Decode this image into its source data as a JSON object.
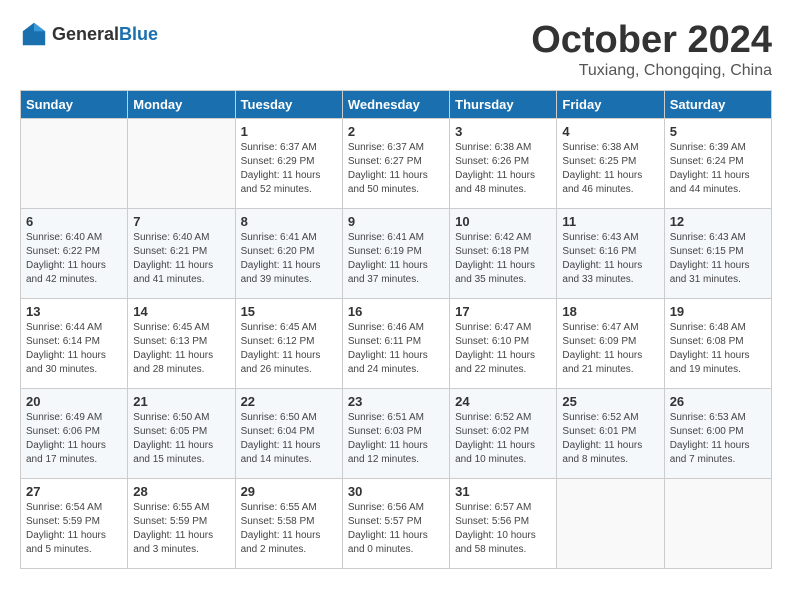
{
  "header": {
    "logo_general": "General",
    "logo_blue": "Blue",
    "month": "October 2024",
    "location": "Tuxiang, Chongqing, China"
  },
  "weekdays": [
    "Sunday",
    "Monday",
    "Tuesday",
    "Wednesday",
    "Thursday",
    "Friday",
    "Saturday"
  ],
  "weeks": [
    [
      {
        "day": "",
        "info": ""
      },
      {
        "day": "",
        "info": ""
      },
      {
        "day": "1",
        "info": "Sunrise: 6:37 AM\nSunset: 6:29 PM\nDaylight: 11 hours\nand 52 minutes."
      },
      {
        "day": "2",
        "info": "Sunrise: 6:37 AM\nSunset: 6:27 PM\nDaylight: 11 hours\nand 50 minutes."
      },
      {
        "day": "3",
        "info": "Sunrise: 6:38 AM\nSunset: 6:26 PM\nDaylight: 11 hours\nand 48 minutes."
      },
      {
        "day": "4",
        "info": "Sunrise: 6:38 AM\nSunset: 6:25 PM\nDaylight: 11 hours\nand 46 minutes."
      },
      {
        "day": "5",
        "info": "Sunrise: 6:39 AM\nSunset: 6:24 PM\nDaylight: 11 hours\nand 44 minutes."
      }
    ],
    [
      {
        "day": "6",
        "info": "Sunrise: 6:40 AM\nSunset: 6:22 PM\nDaylight: 11 hours\nand 42 minutes."
      },
      {
        "day": "7",
        "info": "Sunrise: 6:40 AM\nSunset: 6:21 PM\nDaylight: 11 hours\nand 41 minutes."
      },
      {
        "day": "8",
        "info": "Sunrise: 6:41 AM\nSunset: 6:20 PM\nDaylight: 11 hours\nand 39 minutes."
      },
      {
        "day": "9",
        "info": "Sunrise: 6:41 AM\nSunset: 6:19 PM\nDaylight: 11 hours\nand 37 minutes."
      },
      {
        "day": "10",
        "info": "Sunrise: 6:42 AM\nSunset: 6:18 PM\nDaylight: 11 hours\nand 35 minutes."
      },
      {
        "day": "11",
        "info": "Sunrise: 6:43 AM\nSunset: 6:16 PM\nDaylight: 11 hours\nand 33 minutes."
      },
      {
        "day": "12",
        "info": "Sunrise: 6:43 AM\nSunset: 6:15 PM\nDaylight: 11 hours\nand 31 minutes."
      }
    ],
    [
      {
        "day": "13",
        "info": "Sunrise: 6:44 AM\nSunset: 6:14 PM\nDaylight: 11 hours\nand 30 minutes."
      },
      {
        "day": "14",
        "info": "Sunrise: 6:45 AM\nSunset: 6:13 PM\nDaylight: 11 hours\nand 28 minutes."
      },
      {
        "day": "15",
        "info": "Sunrise: 6:45 AM\nSunset: 6:12 PM\nDaylight: 11 hours\nand 26 minutes."
      },
      {
        "day": "16",
        "info": "Sunrise: 6:46 AM\nSunset: 6:11 PM\nDaylight: 11 hours\nand 24 minutes."
      },
      {
        "day": "17",
        "info": "Sunrise: 6:47 AM\nSunset: 6:10 PM\nDaylight: 11 hours\nand 22 minutes."
      },
      {
        "day": "18",
        "info": "Sunrise: 6:47 AM\nSunset: 6:09 PM\nDaylight: 11 hours\nand 21 minutes."
      },
      {
        "day": "19",
        "info": "Sunrise: 6:48 AM\nSunset: 6:08 PM\nDaylight: 11 hours\nand 19 minutes."
      }
    ],
    [
      {
        "day": "20",
        "info": "Sunrise: 6:49 AM\nSunset: 6:06 PM\nDaylight: 11 hours\nand 17 minutes."
      },
      {
        "day": "21",
        "info": "Sunrise: 6:50 AM\nSunset: 6:05 PM\nDaylight: 11 hours\nand 15 minutes."
      },
      {
        "day": "22",
        "info": "Sunrise: 6:50 AM\nSunset: 6:04 PM\nDaylight: 11 hours\nand 14 minutes."
      },
      {
        "day": "23",
        "info": "Sunrise: 6:51 AM\nSunset: 6:03 PM\nDaylight: 11 hours\nand 12 minutes."
      },
      {
        "day": "24",
        "info": "Sunrise: 6:52 AM\nSunset: 6:02 PM\nDaylight: 11 hours\nand 10 minutes."
      },
      {
        "day": "25",
        "info": "Sunrise: 6:52 AM\nSunset: 6:01 PM\nDaylight: 11 hours\nand 8 minutes."
      },
      {
        "day": "26",
        "info": "Sunrise: 6:53 AM\nSunset: 6:00 PM\nDaylight: 11 hours\nand 7 minutes."
      }
    ],
    [
      {
        "day": "27",
        "info": "Sunrise: 6:54 AM\nSunset: 5:59 PM\nDaylight: 11 hours\nand 5 minutes."
      },
      {
        "day": "28",
        "info": "Sunrise: 6:55 AM\nSunset: 5:59 PM\nDaylight: 11 hours\nand 3 minutes."
      },
      {
        "day": "29",
        "info": "Sunrise: 6:55 AM\nSunset: 5:58 PM\nDaylight: 11 hours\nand 2 minutes."
      },
      {
        "day": "30",
        "info": "Sunrise: 6:56 AM\nSunset: 5:57 PM\nDaylight: 11 hours\nand 0 minutes."
      },
      {
        "day": "31",
        "info": "Sunrise: 6:57 AM\nSunset: 5:56 PM\nDaylight: 10 hours\nand 58 minutes."
      },
      {
        "day": "",
        "info": ""
      },
      {
        "day": "",
        "info": ""
      }
    ]
  ]
}
